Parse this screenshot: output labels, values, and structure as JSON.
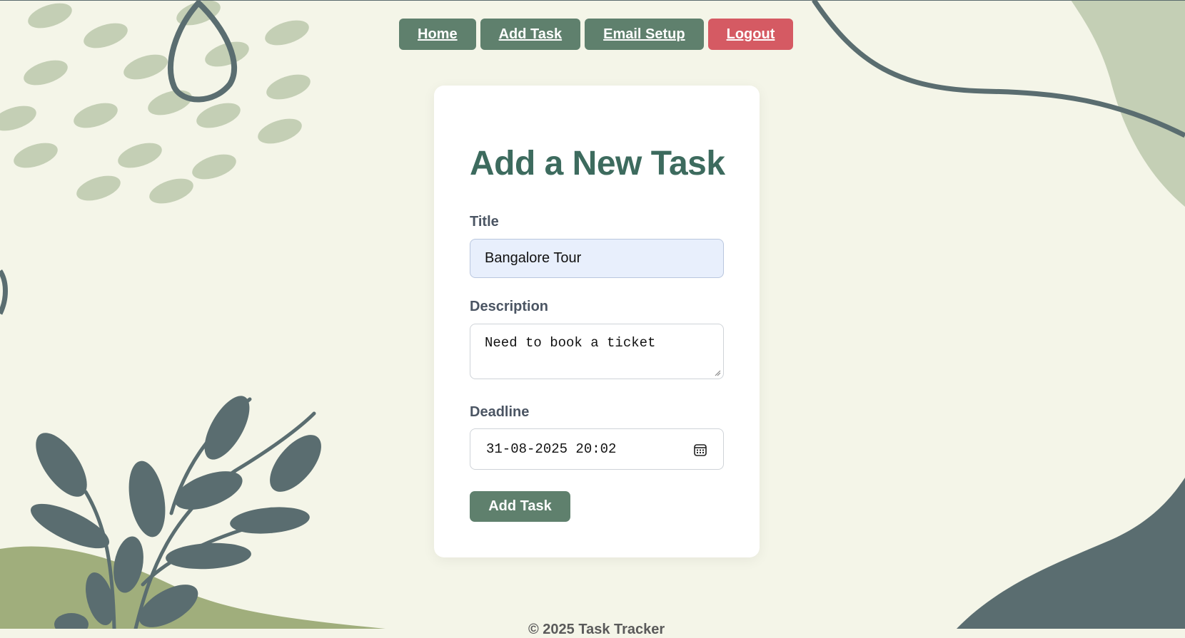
{
  "nav": {
    "home": "Home",
    "add_task": "Add Task",
    "email_setup": "Email Setup",
    "logout": "Logout"
  },
  "form": {
    "heading": "Add a New Task",
    "title_label": "Title",
    "title_value": "Bangalore Tour",
    "description_label": "Description",
    "description_value": "Need to book a ticket",
    "deadline_label": "Deadline",
    "deadline_value": "31-08-2025 20:02",
    "submit_label": "Add Task"
  },
  "footer": {
    "text": "© 2025 Task Tracker"
  },
  "colors": {
    "background": "#f4f5e8",
    "button_green": "#5f806d",
    "logout_red": "#d55a63",
    "heading_green": "#3d6b5e"
  },
  "icons": {
    "deadline_picker": "calendar-icon"
  }
}
